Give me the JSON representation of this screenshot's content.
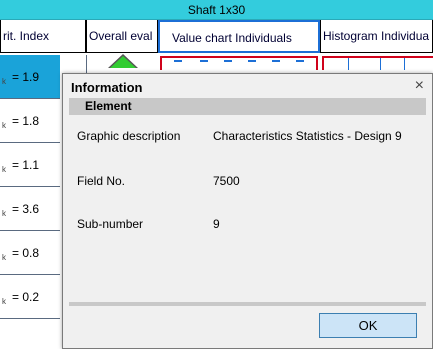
{
  "window": {
    "title": "Shaft 1x30"
  },
  "columns": [
    {
      "label": "rit. Index"
    },
    {
      "label": "Overall eval"
    },
    {
      "label": "Value chart Individuals"
    },
    {
      "label": "Histogram Individua"
    }
  ],
  "rows": [
    {
      "subscript": "k",
      "value": "= 1.9"
    },
    {
      "subscript": "k",
      "value": "= 1.8"
    },
    {
      "subscript": "k",
      "value": "= 1.1"
    },
    {
      "subscript": "k",
      "value": "= 3.6"
    },
    {
      "subscript": "k",
      "value": "= 0.8"
    },
    {
      "subscript": "k",
      "value": "= 0.2"
    }
  ],
  "dialog": {
    "title": "Information",
    "close_icon": "×",
    "section": "Element",
    "fields": [
      {
        "label": "Graphic description",
        "value": "Characteristics Statistics - Design 9"
      },
      {
        "label": "Field No.",
        "value": "7500"
      },
      {
        "label": "Sub-number",
        "value": "9"
      }
    ],
    "ok_label": "OK"
  },
  "colors": {
    "title_bar": "#33ccdd",
    "selected_row": "#1aa3d9",
    "ok_button": "#cce4f7",
    "section_bar": "#c8c8c8"
  }
}
